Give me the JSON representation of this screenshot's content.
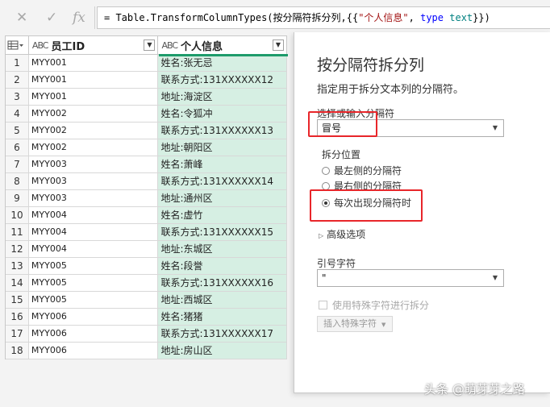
{
  "formula_bar": {
    "cancel_icon": "close-icon",
    "confirm_icon": "check-icon",
    "fx_label": "fx",
    "formula_prefix": "= Table.TransformColumnTypes(按分隔符拆分列,{{",
    "formula_string": "\"个人信息\"",
    "formula_comma": ", ",
    "formula_keyword": "type",
    "formula_space": " ",
    "formula_type": "text",
    "formula_suffix": "}})"
  },
  "table": {
    "columns": [
      {
        "type_icon": "ABC",
        "label": "员工ID"
      },
      {
        "type_icon": "ABC",
        "label": "个人信息"
      }
    ],
    "rows": [
      {
        "n": "1",
        "id": "MYY001",
        "info": "姓名:张无忌"
      },
      {
        "n": "2",
        "id": "MYY001",
        "info": "联系方式:131XXXXXX12"
      },
      {
        "n": "3",
        "id": "MYY001",
        "info": "地址:海淀区"
      },
      {
        "n": "4",
        "id": "MYY002",
        "info": "姓名:令狐冲"
      },
      {
        "n": "5",
        "id": "MYY002",
        "info": "联系方式:131XXXXXX13"
      },
      {
        "n": "6",
        "id": "MYY002",
        "info": "地址:朝阳区"
      },
      {
        "n": "7",
        "id": "MYY003",
        "info": "姓名:萧峰"
      },
      {
        "n": "8",
        "id": "MYY003",
        "info": "联系方式:131XXXXXX14"
      },
      {
        "n": "9",
        "id": "MYY003",
        "info": "地址:通州区"
      },
      {
        "n": "10",
        "id": "MYY004",
        "info": "姓名:虚竹"
      },
      {
        "n": "11",
        "id": "MYY004",
        "info": "联系方式:131XXXXXX15"
      },
      {
        "n": "12",
        "id": "MYY004",
        "info": "地址:东城区"
      },
      {
        "n": "13",
        "id": "MYY005",
        "info": "姓名:段誉"
      },
      {
        "n": "14",
        "id": "MYY005",
        "info": "联系方式:131XXXXXX16"
      },
      {
        "n": "15",
        "id": "MYY005",
        "info": "地址:西城区"
      },
      {
        "n": "16",
        "id": "MYY006",
        "info": "姓名:猪猪"
      },
      {
        "n": "17",
        "id": "MYY006",
        "info": "联系方式:131XXXXXX17"
      },
      {
        "n": "18",
        "id": "MYY006",
        "info": "地址:房山区"
      }
    ]
  },
  "panel": {
    "title": "按分隔符拆分列",
    "description": "指定用于拆分文本列的分隔符。",
    "delimiter_label": "选择或输入分隔符",
    "delimiter_value": "冒号",
    "split_at_label": "拆分位置",
    "split_options": [
      {
        "label": "最左侧的分隔符",
        "selected": false
      },
      {
        "label": "最右侧的分隔符",
        "selected": false
      },
      {
        "label": "每次出现分隔符时",
        "selected": true
      }
    ],
    "advanced_label": "高级选项",
    "quote_label": "引号字符",
    "quote_value": "\"",
    "special_chars_label": "使用特殊字符进行拆分",
    "insert_special_label": "插入特殊字符"
  },
  "watermark": "头条 @萌芽芽之路",
  "colors": {
    "accent": "#1e9b6b",
    "selected_column_bg": "#d6efe3",
    "highlight_box": "#e8262a"
  }
}
